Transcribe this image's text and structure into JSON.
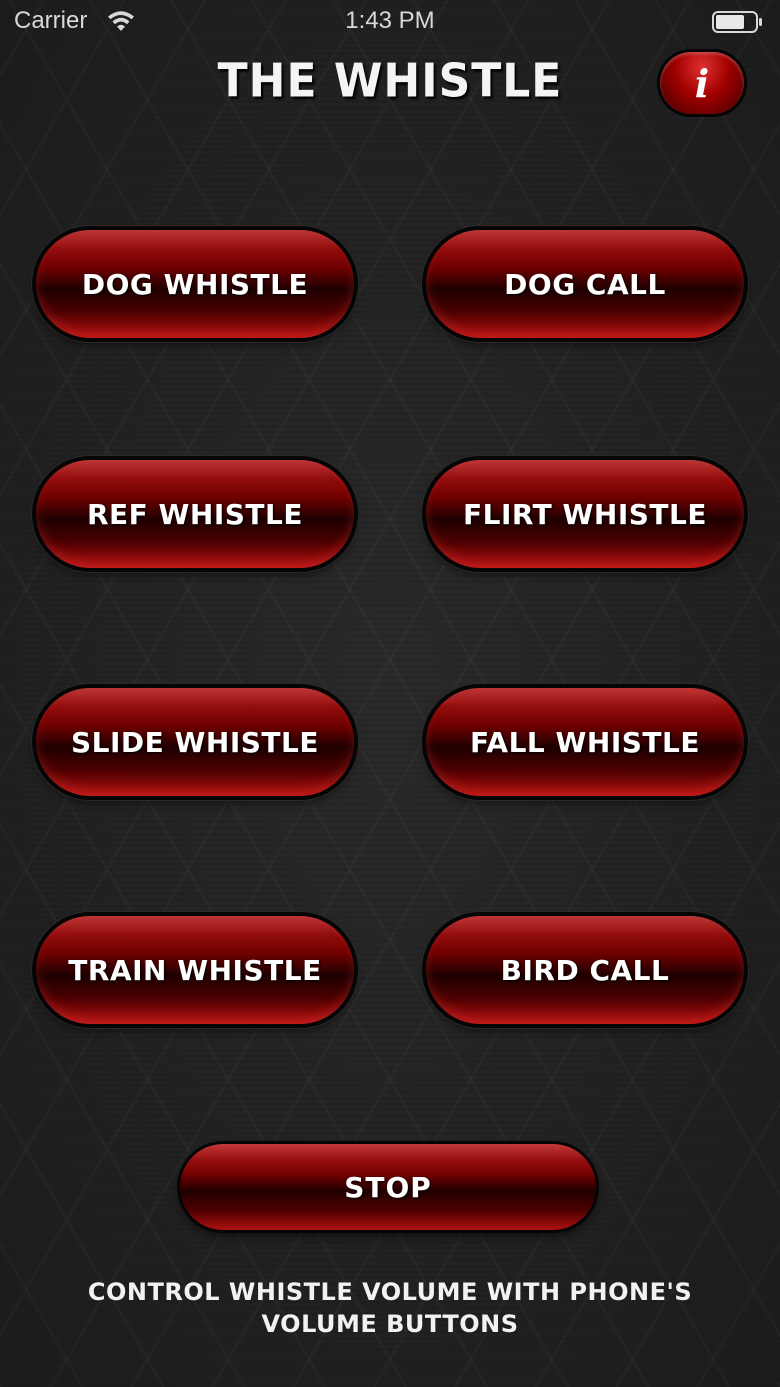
{
  "status_bar": {
    "carrier": "Carrier",
    "time": "1:43 PM",
    "wifi_icon": "wifi-icon",
    "battery_icon": "battery-icon"
  },
  "header": {
    "title": "THE WHISTLE",
    "info_label": "i",
    "info_icon": "info-icon"
  },
  "buttons": [
    {
      "label": "DOG WHISTLE"
    },
    {
      "label": "DOG CALL"
    },
    {
      "label": "REF WHISTLE"
    },
    {
      "label": "FLIRT WHISTLE"
    },
    {
      "label": "SLIDE WHISTLE"
    },
    {
      "label": "FALL WHISTLE"
    },
    {
      "label": "TRAIN WHISTLE"
    },
    {
      "label": "BIRD CALL"
    }
  ],
  "stop": {
    "label": "STOP"
  },
  "footer": {
    "line1": "CONTROL WHISTLE VOLUME WITH PHONE'S",
    "line2": "VOLUME BUTTONS"
  },
  "colors": {
    "accent": "#a00000",
    "background": "#202020",
    "text": "#ffffff"
  }
}
